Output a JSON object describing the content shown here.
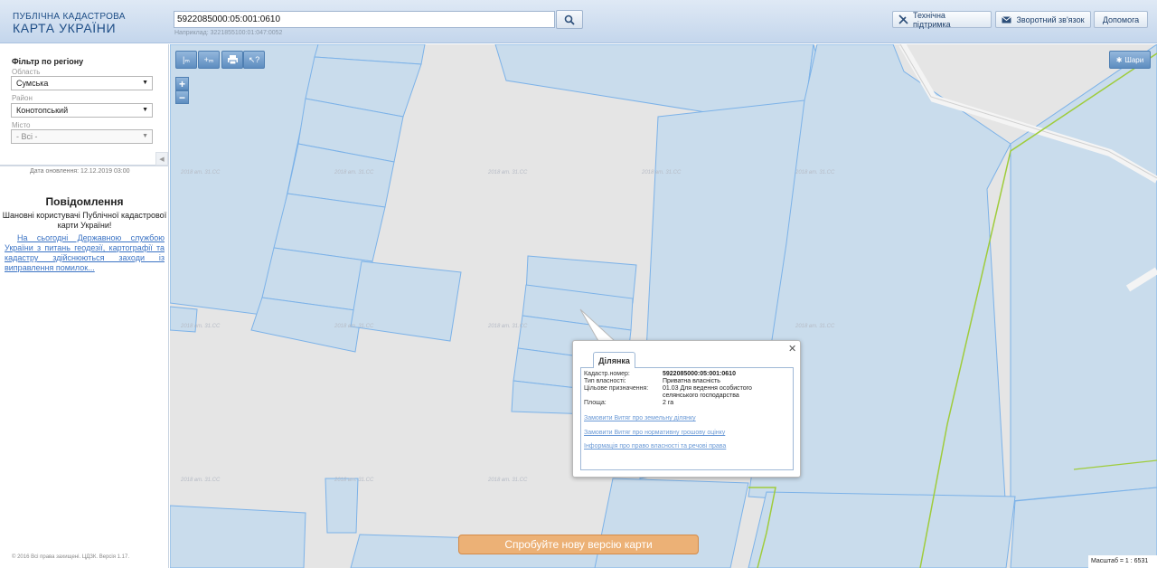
{
  "header": {
    "logo_line1": "ПУБЛІЧНА КАДАСТРОВА",
    "logo_line2": "КАРТА УКРАЇНИ",
    "search_value": "5922085000:05:001:0610",
    "search_hint": "Наприклад: 3221855100:01:047:0052",
    "tech_support": "Технічна підтримка",
    "feedback": "Зворотний зв'язок",
    "help": "Допомога"
  },
  "sidebar": {
    "filter_title": "Фільтр по регіону",
    "oblast_label": "Область",
    "oblast_value": "Сумська",
    "raion_label": "Район",
    "raion_value": "Конотопський",
    "misto_label": "Місто",
    "misto_value": "- Всі -",
    "update_date": "Дата оновлення: 12.12.2019 03:00",
    "notice_title": "Повідомлення",
    "notice_text": "Шановні користувачі Публічної кадастрової карти України!",
    "notice_link": "На сьогодні Державною службою України з питань геодезії, картографії та кадастру здійснюються заходи із виправлення помилок...",
    "copyright": "© 2016 Всі права захищені. ЦДЗК. Версія 1.17."
  },
  "map": {
    "layers_label": "Шари",
    "zoom_in": "+",
    "zoom_out": "−",
    "new_version": "Спробуйте нову версію карти",
    "scale": "Масштаб = 1 : 6531",
    "watermark": "2018 вт. 31.СС"
  },
  "popup": {
    "tab": "Ділянка",
    "cadastral_label": "Кадастр.номер:",
    "cadastral_value": "5922085000:05:001:0610",
    "ownership_label": "Тип власності:",
    "ownership_value": "Приватна власність",
    "purpose_label": "Цільове призначення:",
    "purpose_value": "01.03 Для ведення особистого селянського господарства",
    "area_label": "Площа:",
    "area_value": "2 га",
    "link1": "Замовити Витяг про земельну ділянку",
    "link2": "Замовити Витяг про нормативну грошову оцінку",
    "link3": "Інформація про право власності та речові права"
  },
  "colors": {
    "parcel_fill": "#c9dcec",
    "parcel_stroke": "#7cb2e8",
    "boundary": "#9fcc3b",
    "road": "#f7f7f7"
  }
}
